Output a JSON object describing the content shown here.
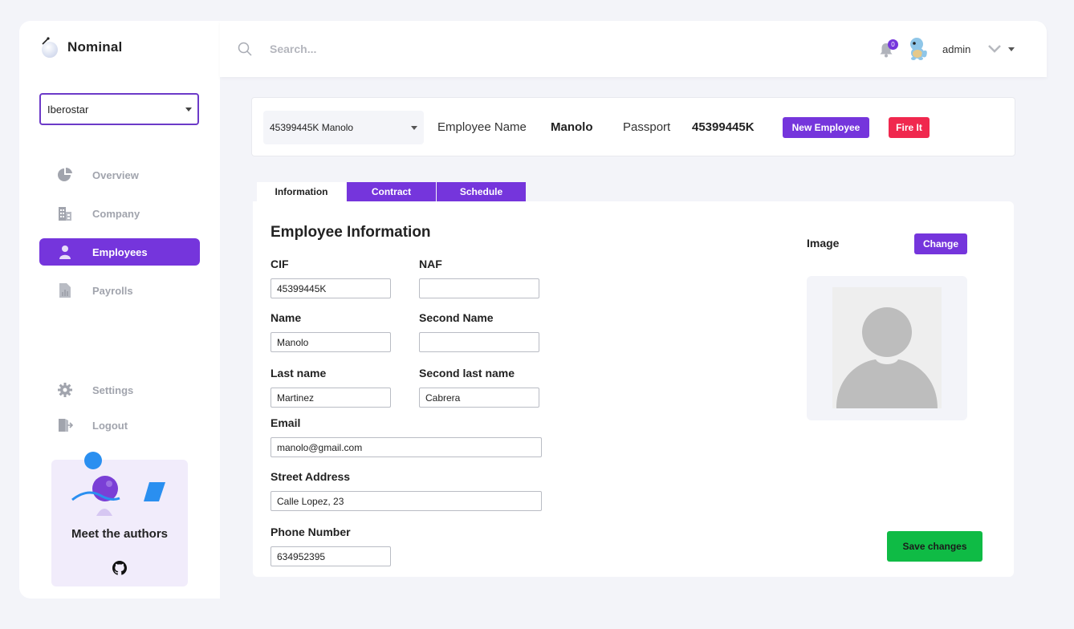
{
  "app": {
    "name": "Nominal"
  },
  "company_select": {
    "value": "Iberostar"
  },
  "sidebar": {
    "items": [
      {
        "label": "Overview",
        "icon": "pie-chart-icon",
        "active": false
      },
      {
        "label": "Company",
        "icon": "building-icon",
        "active": false
      },
      {
        "label": "Employees",
        "icon": "user-icon",
        "active": true
      },
      {
        "label": "Payrolls",
        "icon": "report-icon",
        "active": false
      }
    ],
    "bottom_items": [
      {
        "label": "Settings",
        "icon": "gear-icon"
      },
      {
        "label": "Logout",
        "icon": "logout-icon"
      }
    ],
    "authors_card": {
      "title": "Meet the authors",
      "icon": "github-icon"
    }
  },
  "topbar": {
    "search_placeholder": "Search...",
    "notification_count": "0",
    "user_name": "admin"
  },
  "employee_header": {
    "selected_employee": "45399445K Manolo",
    "name_label": "Employee Name",
    "name_value": "Manolo",
    "passport_label": "Passport",
    "passport_value": "45399445K",
    "new_button": "New Employee",
    "fire_button": "Fire It"
  },
  "tabs": [
    {
      "label": "Information",
      "active": true
    },
    {
      "label": "Contract",
      "active": false
    },
    {
      "label": "Schedule",
      "active": false
    }
  ],
  "form": {
    "title": "Employee Information",
    "fields": {
      "cif": {
        "label": "CIF",
        "value": "45399445K"
      },
      "naf": {
        "label": "NAF",
        "value": ""
      },
      "name": {
        "label": "Name",
        "value": "Manolo"
      },
      "second_name": {
        "label": "Second Name",
        "value": ""
      },
      "last_name": {
        "label": "Last name",
        "value": "Martinez"
      },
      "second_last_name": {
        "label": "Second last name",
        "value": "Cabrera"
      },
      "email": {
        "label": "Email",
        "value": "manolo@gmail.com"
      },
      "street_address": {
        "label": "Street Address",
        "value": "Calle Lopez, 23"
      },
      "phone_number": {
        "label": "Phone Number",
        "value": "634952395"
      }
    },
    "image_label": "Image",
    "change_button": "Change",
    "save_button": "Save changes"
  },
  "colors": {
    "accent": "#7535dc",
    "danger": "#f0284e",
    "success": "#0fbb45",
    "background": "#f3f4f9"
  }
}
